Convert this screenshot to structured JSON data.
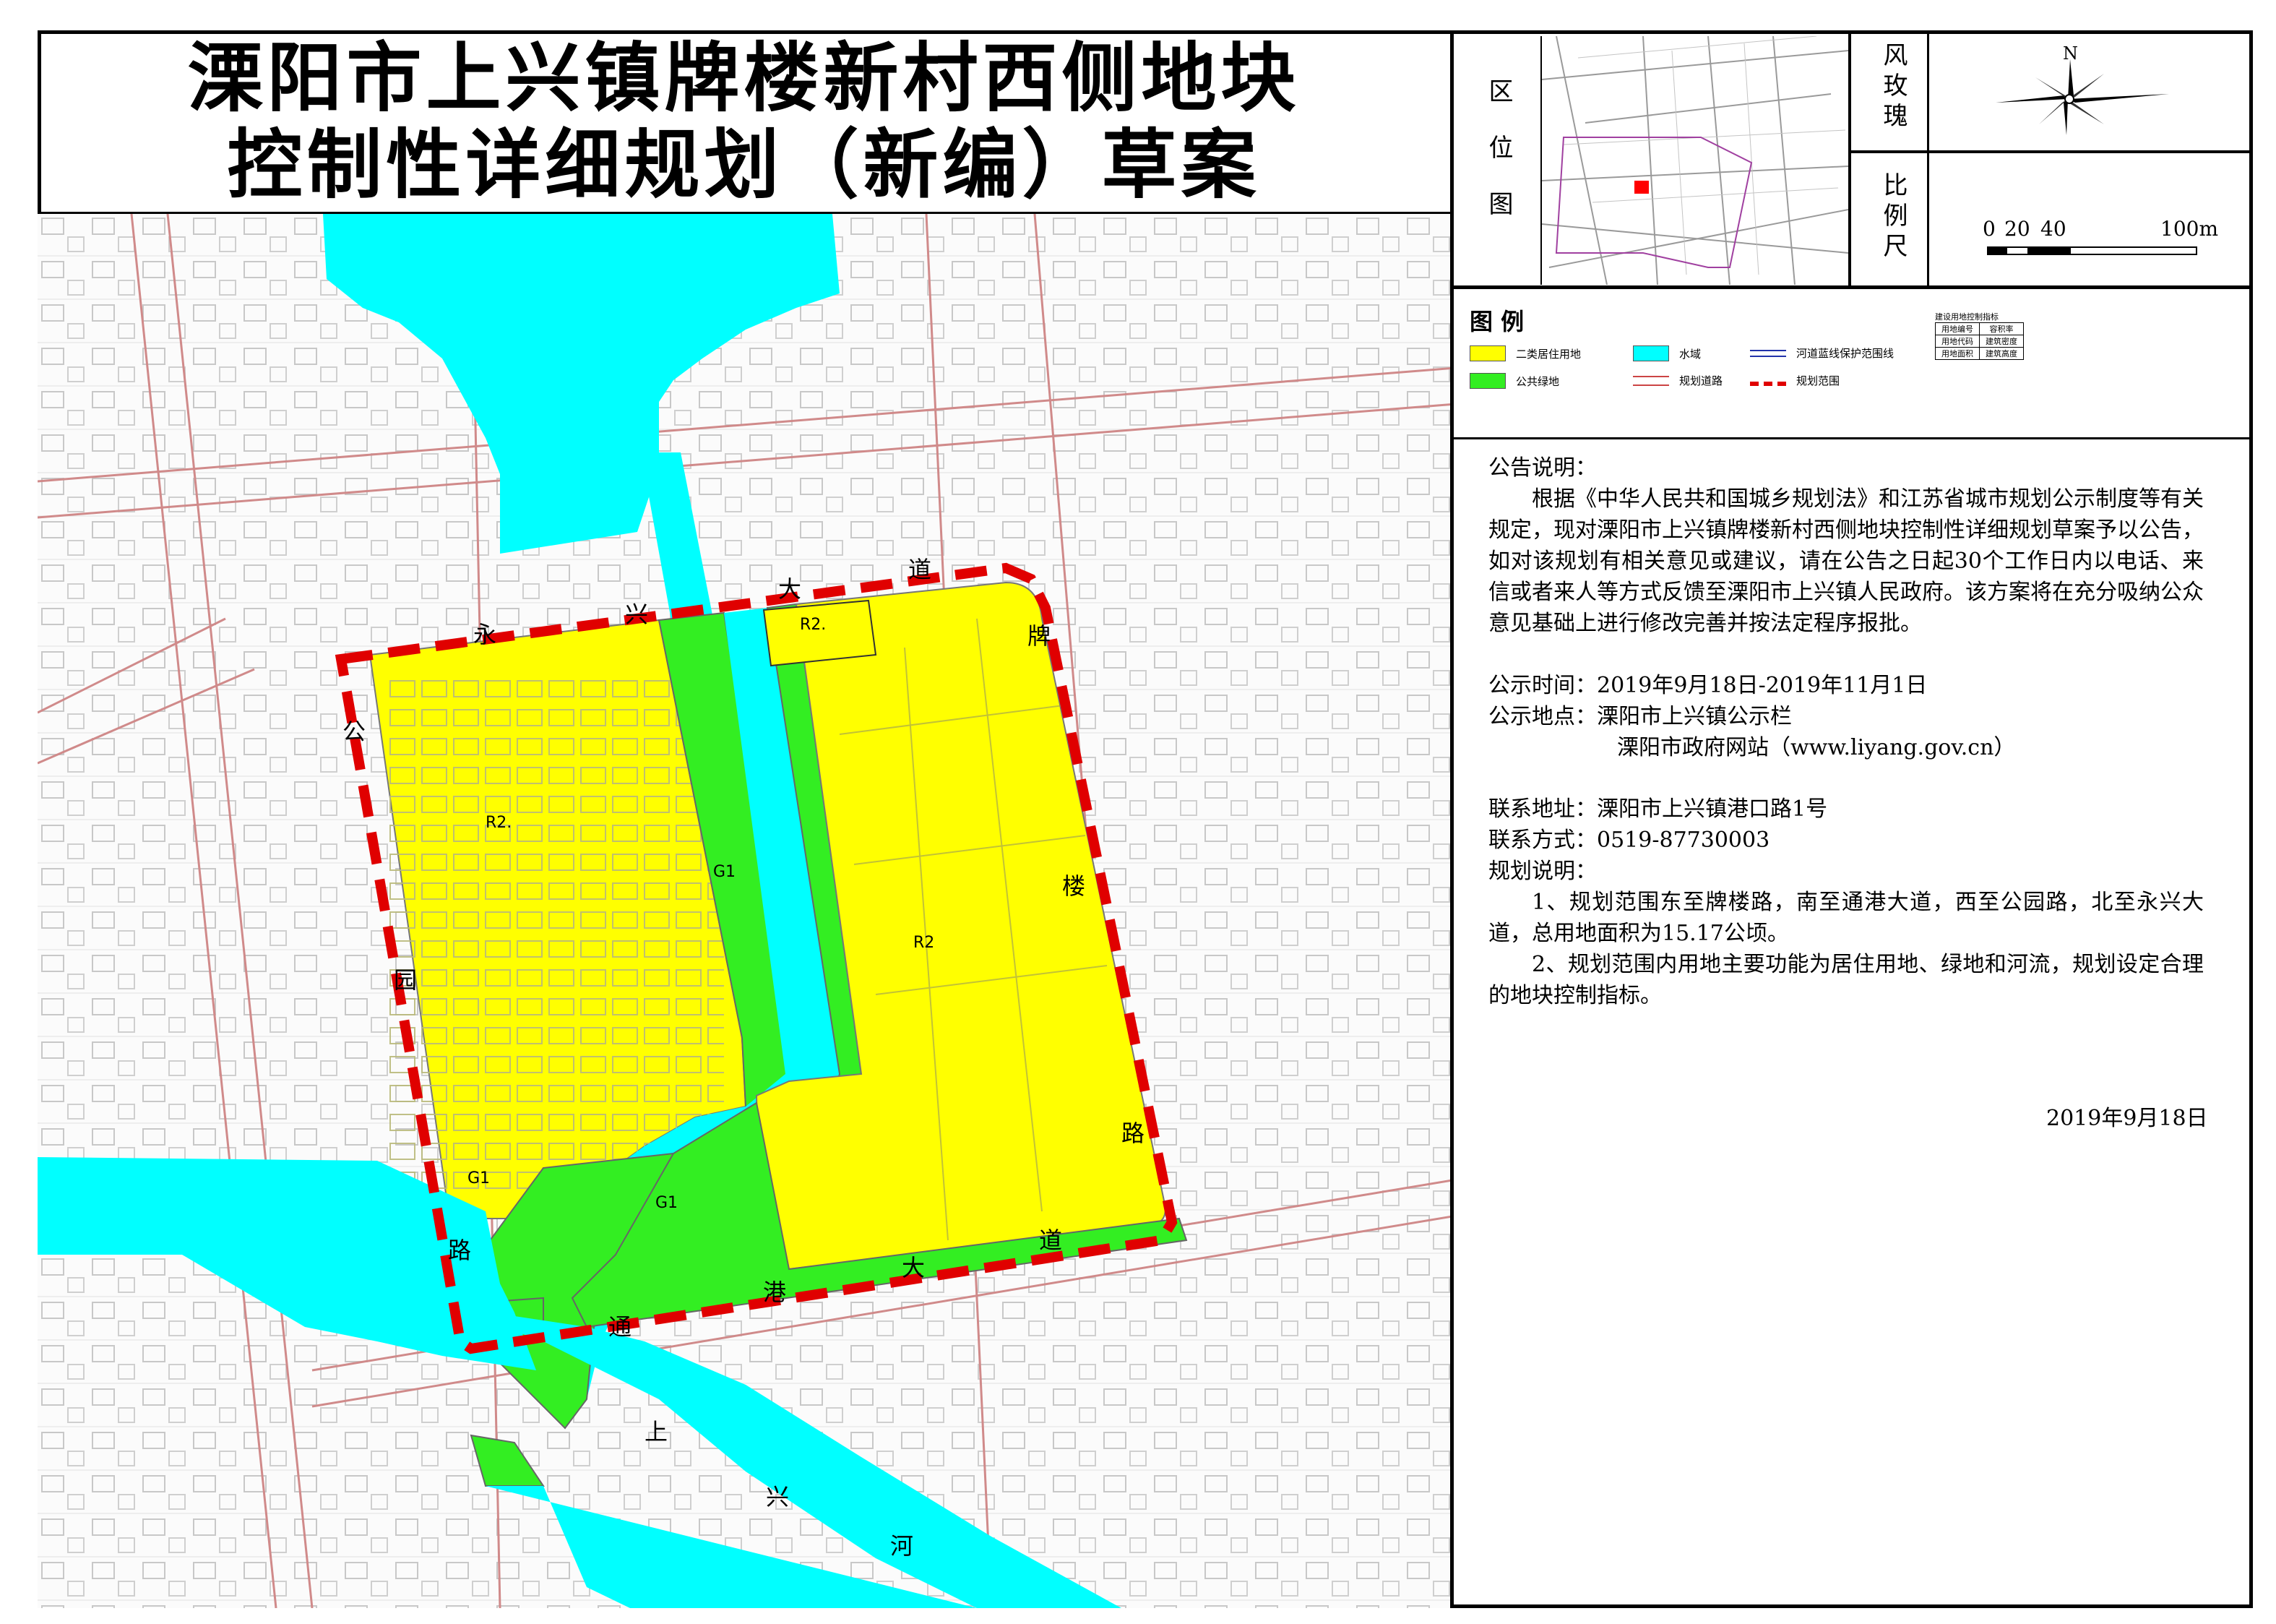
{
  "title": {
    "line1": "溧阳市上兴镇牌楼新村西侧地块",
    "line2": "控制性详细规划（新编）草案"
  },
  "location_map": {
    "label_chars": [
      "区",
      "位",
      "图"
    ]
  },
  "compass": {
    "label_chars": [
      "风",
      "玫",
      "瑰"
    ],
    "north": "N"
  },
  "scale_bar": {
    "label_chars": [
      "比",
      "例",
      "尺"
    ],
    "ticks": [
      "0",
      "20",
      "40",
      "100m"
    ]
  },
  "legend": {
    "title": "图 例",
    "items": [
      {
        "label": "二类居住用地",
        "kind": "fill",
        "color": "#ffff00"
      },
      {
        "label": "水域",
        "kind": "fill",
        "color": "#00ffff"
      },
      {
        "label": "河道蓝线保护范围线",
        "kind": "blueline",
        "color": "#2233aa"
      },
      {
        "label": "公共绿地",
        "kind": "fill",
        "color": "#33ee22"
      },
      {
        "label": "规划道路",
        "kind": "road",
        "color": "#cc4444"
      },
      {
        "label": "规划范围",
        "kind": "boundary",
        "color": "#e00000"
      }
    ],
    "index_table": {
      "title": "建设用地控制指标",
      "rows": [
        [
          "用地编号",
          "容积率"
        ],
        [
          "用地代码",
          "建筑密度"
        ],
        [
          "用地面积",
          "建筑高度"
        ]
      ]
    }
  },
  "notice": {
    "heading": "公告说明：",
    "body": "根据《中华人民共和国城乡规划法》和江苏省城市规划公示制度等有关规定，现对溧阳市上兴镇牌楼新村西侧地块控制性详细规划草案予以公告，如对该规划有相关意见或建议，请在公告之日起30个工作日内以电话、来信或者来人等方式反馈至溧阳市上兴镇人民政府。该方案将在充分吸纳公众意见基础上进行修改完善并按法定程序报批。",
    "time_label": "公示时间：2019年9月18日-2019年11月1日",
    "place_label": "公示地点：溧阳市上兴镇公示栏",
    "place_2": "溧阳市政府网站（www.liyang.gov.cn）",
    "contact_address": "联系地址：溧阳市上兴镇港口路1号",
    "contact_phone": "联系方式：0519-87730003",
    "plan_heading": "规划说明：",
    "plan_1": "1、规划范围东至牌楼路，南至通港大道，西至公园路，北至永兴大道，总用地面积为15.17公顷。",
    "plan_2": "2、规划范围内用地主要功能为居住用地、绿地和河流，规划设定合理的地块控制指标。",
    "date": "2019年9月18日"
  },
  "map": {
    "parcel_labels": {
      "r2_west": "R2.",
      "r2_north": "R2.",
      "r2_east": "R2",
      "g1_strip": "G1",
      "g1_west": "G1",
      "g1_south": "G1"
    },
    "road_chars": {
      "north": [
        "永",
        "兴",
        "大",
        "道"
      ],
      "west": [
        "公",
        "园",
        "路"
      ],
      "east": [
        "牌",
        "楼",
        "路"
      ],
      "south": [
        "通",
        "港",
        "大",
        "道"
      ]
    },
    "river_chars": [
      "上",
      "兴",
      "河"
    ],
    "colors": {
      "residential": "#ffff00",
      "green": "#33ee22",
      "water": "#00ffff",
      "boundary": "#e00000",
      "road": "#cc4444"
    }
  }
}
